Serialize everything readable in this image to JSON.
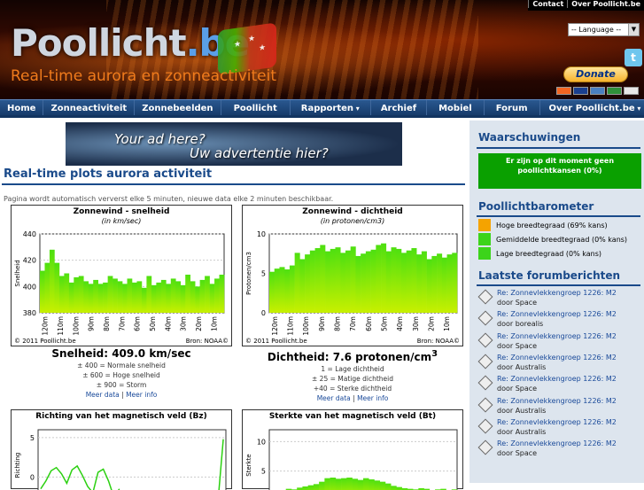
{
  "header": {
    "logo_a": "Poollicht",
    "logo_b": ".be",
    "tagline": "Real-time aurora en zonneactiviteit",
    "top_links": [
      "Contact",
      "Over Poollicht.be"
    ],
    "language": "-- Language --",
    "donate": "Donate"
  },
  "nav": [
    "Home",
    "Zonneactiviteit",
    "Zonnebeelden",
    "Poollicht",
    "Rapporten",
    "Archief",
    "Mobiel",
    "Forum",
    "Over Poollicht.be"
  ],
  "ad": {
    "line1": "Your ad here?",
    "line2": "Uw advertentie hier?"
  },
  "main": {
    "title": "Real-time plots aurora activiteit",
    "note": "Pagina wordt automatisch ververst elke 5 minuten, nieuwe data elke 2 minuten beschikbaar."
  },
  "charts": {
    "speed": {
      "title": "Zonnewind - snelheid",
      "subtitle": "(in km/sec)",
      "ylabel": "Snelheid",
      "yticks": [
        "440",
        "420",
        "400",
        "380"
      ],
      "xticks": [
        "120m",
        "110m",
        "100m",
        "90m",
        "80m",
        "70m",
        "60m",
        "50m",
        "40m",
        "30m",
        "20m",
        "10m"
      ],
      "footer_left": "© 2011 Poollicht.be",
      "footer_right": "Bron:  NOAA©",
      "value": "Snelheid: 409.0 km/sec",
      "legend": [
        "± 400 = Normale snelheid",
        "± 600 = Hoge snelheid",
        "± 900 = Storm"
      ],
      "link_a": "Meer data",
      "link_b": "Meer info"
    },
    "density": {
      "title": "Zonnewind - dichtheid",
      "subtitle": "(in protonen/cm3)",
      "ylabel": "Protonen/cm3",
      "yticks": [
        "10",
        "5",
        "0"
      ],
      "xticks": [
        "120m",
        "110m",
        "100m",
        "90m",
        "80m",
        "70m",
        "60m",
        "50m",
        "40m",
        "30m",
        "20m",
        "10m"
      ],
      "footer_left": "© 2011 Poollicht.be",
      "footer_right": "Bron:  NOAA©",
      "value": "Dichtheid: 7.6 protonen/cm",
      "value_sup": "3",
      "legend": [
        "1 = Lage dichtheid",
        "± 25 = Matige dichtheid",
        "+40 = Sterke dichtheid"
      ],
      "link_a": "Meer data",
      "link_b": "Meer info"
    },
    "bz": {
      "title": "Richting van het magnetisch veld (Bz)",
      "ylabel": "Richting",
      "yticks": [
        "5",
        "0"
      ]
    },
    "bt": {
      "title": "Sterkte van het magnetisch veld (Bt)",
      "ylabel": "Sterkte",
      "yticks": [
        "10",
        "5"
      ]
    }
  },
  "chart_data": [
    {
      "type": "area",
      "title": "Zonnewind - snelheid",
      "ylabel": "Snelheid",
      "ylim": [
        380,
        440
      ],
      "x": [
        "120m",
        "110m",
        "100m",
        "90m",
        "80m",
        "70m",
        "60m",
        "50m",
        "40m",
        "30m",
        "20m",
        "10m"
      ],
      "values": [
        412,
        418,
        428,
        418,
        408,
        410,
        403,
        407,
        408,
        404,
        402,
        405,
        402,
        403,
        408,
        406,
        404,
        402,
        406,
        403,
        404,
        399,
        408,
        401,
        403,
        405,
        402,
        406,
        404,
        401,
        409,
        404,
        400,
        405,
        408,
        402,
        406,
        409
      ]
    },
    {
      "type": "area",
      "title": "Zonnewind - dichtheid",
      "ylabel": "Protonen/cm3",
      "ylim": [
        0,
        10
      ],
      "x": [
        "120m",
        "110m",
        "100m",
        "90m",
        "80m",
        "70m",
        "60m",
        "50m",
        "40m",
        "30m",
        "20m",
        "10m"
      ],
      "values": [
        5.2,
        5.6,
        5.8,
        5.5,
        6.0,
        7.6,
        6.8,
        7.4,
        7.9,
        8.2,
        8.6,
        7.8,
        8.1,
        8.3,
        7.6,
        7.9,
        8.4,
        7.2,
        7.5,
        7.8,
        8.0,
        8.6,
        8.8,
        7.8,
        8.3,
        8.1,
        7.6,
        7.9,
        8.2,
        7.4,
        7.8,
        6.8,
        7.2,
        7.5,
        7.0,
        7.4,
        7.6
      ]
    },
    {
      "type": "line",
      "title": "Richting van het magnetisch veld (Bz)",
      "ylim": [
        -3,
        6
      ],
      "values": [
        -1.5,
        -0.5,
        0.8,
        1.2,
        0.4,
        -0.8,
        0.9,
        1.4,
        0.2,
        -1.2,
        -2.0,
        0.6,
        1.0,
        -0.5,
        -2.5,
        -1.6,
        -2.8,
        -3,
        -3,
        -3,
        -3,
        -3,
        -3,
        -3,
        -3,
        -3,
        -3,
        -3,
        -3,
        -3,
        -3,
        -3,
        -3,
        -3,
        -3,
        4.8
      ]
    },
    {
      "type": "area",
      "title": "Sterkte van het magnetisch veld (Bt)",
      "ylim": [
        0,
        12
      ],
      "values": [
        1.5,
        1.6,
        1.8,
        2.0,
        1.9,
        2.2,
        2.4,
        2.6,
        2.8,
        3.2,
        3.8,
        3.9,
        3.7,
        3.8,
        3.9,
        3.7,
        3.5,
        3.8,
        3.6,
        3.4,
        3.2,
        2.9,
        2.5,
        2.3,
        2.1,
        2.0,
        1.9,
        2.1,
        2.0,
        1.8,
        1.9,
        2.0,
        1.8,
        1.9
      ]
    }
  ],
  "sidebar": {
    "warn_title": "Waarschuwingen",
    "warn_text": "Er zijn op dit moment geen poollichtkansen (0%)",
    "baro_title": "Poollichtbarometer",
    "baro": [
      {
        "label": "Hoge breedtegraad (69% kans)",
        "color": "#f5a300"
      },
      {
        "label": "Gemiddelde breedtegraad (0% kans)",
        "color": "#3cd41a"
      },
      {
        "label": "Lage breedtegraad (0% kans)",
        "color": "#3cd41a"
      }
    ],
    "forum_title": "Laatste forumberichten",
    "forum": [
      {
        "title": "Re: Zonnevlekkengroep 1226: M2",
        "by": "door Space"
      },
      {
        "title": "Re: Zonnevlekkengroep 1226: M2",
        "by": "door borealis"
      },
      {
        "title": "Re: Zonnevlekkengroep 1226: M2",
        "by": "door Space"
      },
      {
        "title": "Re: Zonnevlekkengroep 1226: M2",
        "by": "door Australis"
      },
      {
        "title": "Re: Zonnevlekkengroep 1226: M2",
        "by": "door Space"
      },
      {
        "title": "Re: Zonnevlekkengroep 1226: M2",
        "by": "door Australis"
      },
      {
        "title": "Re: Zonnevlekkengroep 1226: M2",
        "by": "door Australis"
      },
      {
        "title": "Re: Zonnevlekkengroep 1226: M2",
        "by": "door Space"
      }
    ]
  }
}
